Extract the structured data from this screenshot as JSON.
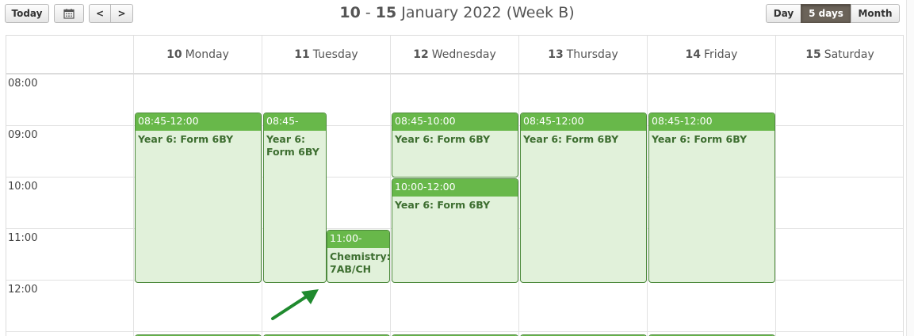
{
  "toolbar": {
    "today_label": "Today",
    "calendar_icon": "calendar-icon",
    "prev_label": "<",
    "next_label": ">",
    "title_bold": "10",
    "title_sep": " - ",
    "title_bold2": "15",
    "title_rest": " January 2022 (Week B)",
    "views": [
      {
        "label": "Day",
        "active": false
      },
      {
        "label": "5 days",
        "active": true
      },
      {
        "label": "Month",
        "active": false
      }
    ]
  },
  "days": [
    {
      "num": "10",
      "name": "Monday"
    },
    {
      "num": "11",
      "name": "Tuesday"
    },
    {
      "num": "12",
      "name": "Wednesday"
    },
    {
      "num": "13",
      "name": "Thursday"
    },
    {
      "num": "14",
      "name": "Friday"
    },
    {
      "num": "15",
      "name": "Saturday"
    }
  ],
  "times": [
    "08:00",
    "09:00",
    "10:00",
    "11:00",
    "12:00"
  ],
  "events": [
    {
      "time": "08:45-12:00",
      "title": "Year 6: Form 6BY"
    },
    {
      "time": "08:45-",
      "title": "Year 6: Form 6BY"
    },
    {
      "time": "11:00-",
      "title": "Chemistry: 7AB/CH"
    },
    {
      "time": "08:45-10:00",
      "title": "Year 6: Form 6BY"
    },
    {
      "time": "10:00-12:00",
      "title": "Year 6: Form 6BY"
    },
    {
      "time": "08:45-12:00",
      "title": "Year 6: Form 6BY"
    },
    {
      "time": "08:45-12:00",
      "title": "Year 6: Form 6BY"
    }
  ],
  "colors": {
    "event_header": "#68b84a",
    "event_body": "#e1f1da",
    "event_border": "#4d8a3c",
    "arrow": "#1f8a2e"
  }
}
